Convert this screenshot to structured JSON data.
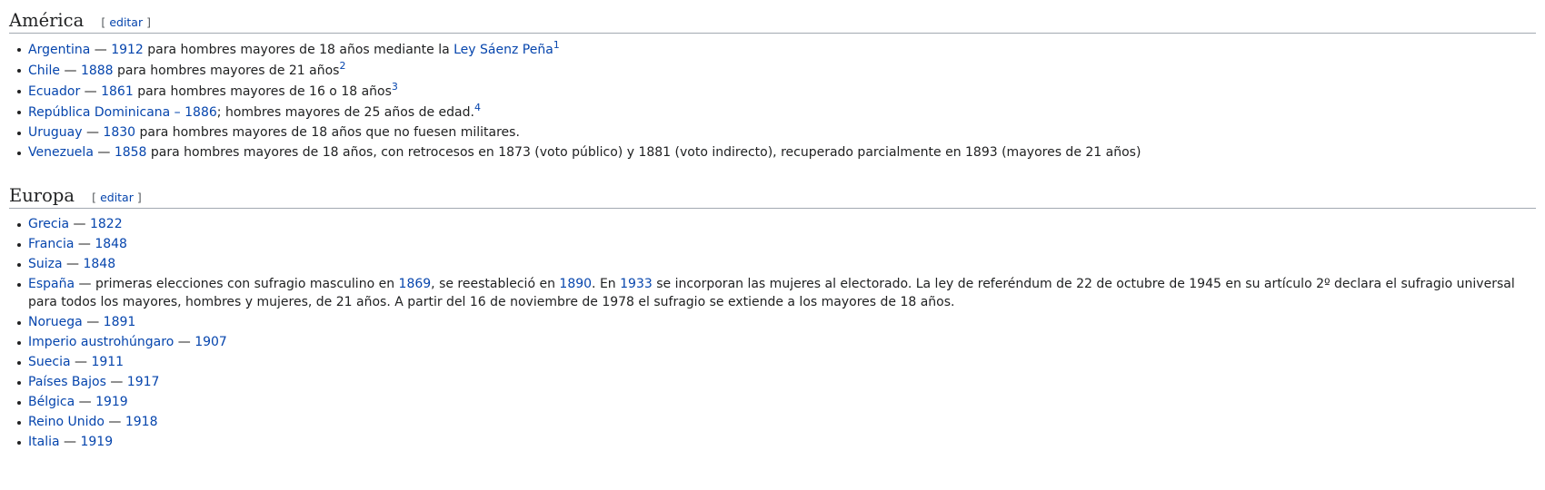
{
  "sections": {
    "america": {
      "title": "América",
      "edit": "editar",
      "items": [
        {
          "link": "Argentina",
          "sep": " — ",
          "year": "1912",
          "text": " para hombres mayores de 18 años mediante la ",
          "link2": "Ley Sáenz Peña",
          "ref": "1"
        },
        {
          "link": "Chile",
          "sep": " — ",
          "year": "1888",
          "text": " para hombres mayores de 21 años",
          "ref": "2"
        },
        {
          "link": "Ecuador",
          "sep": " — ",
          "year": "1861",
          "text": " para hombres mayores de 16 o 18 años",
          "ref": "3"
        },
        {
          "link": "República Dominicana",
          "sep": " – ",
          "year": "1886",
          "text": "; hombres mayores de 25 años de edad.",
          "ref": "4"
        },
        {
          "link": "Uruguay",
          "sep": " — ",
          "year": "1830",
          "text": " para hombres mayores de 18 años que no fuesen militares."
        },
        {
          "link": "Venezuela",
          "sep": " — ",
          "year": "1858",
          "text": " para hombres mayores de 18 años, con retrocesos en 1873 (voto público) y 1881 (voto indirecto), recuperado parcialmente en 1893 (mayores de 21 años)"
        }
      ]
    },
    "europa": {
      "title": "Europa",
      "edit": "editar",
      "items": [
        {
          "link": "Grecia",
          "sep": " — ",
          "year": "1822"
        },
        {
          "link": "Francia",
          "sep": " — ",
          "year": "1848"
        },
        {
          "link": "Suiza",
          "sep": " — ",
          "year": "1848"
        },
        {
          "link": "España",
          "sep": " — ",
          "text_a": "primeras elecciones con sufragio masculino en ",
          "year_a": "1869",
          "text_b": ", se reestableció en ",
          "year_b": "1890",
          "text_c": ". En ",
          "year_c": "1933",
          "text_d": " se incorporan las mujeres al electorado. La ley de referéndum de 22 de octubre de 1945 en su artículo 2º declara el sufragio universal para todos los mayores, hombres y mujeres, de 21 años. A partir del 16 de noviembre de 1978 el sufragio se extiende a los mayores de 18 años."
        },
        {
          "link": "Noruega",
          "sep": " — ",
          "year": "1891"
        },
        {
          "link": "Imperio austrohúngaro",
          "sep": " — ",
          "year": "1907"
        },
        {
          "link": "Suecia",
          "sep": " — ",
          "year": "1911"
        },
        {
          "link": "Países Bajos",
          "sep": " — ",
          "year": "1917"
        },
        {
          "link": "Bélgica",
          "sep": " — ",
          "year": "1919"
        },
        {
          "link": "Reino Unido",
          "sep": " — ",
          "year": "1918"
        },
        {
          "link": "Italia",
          "sep": " — ",
          "year": "1919"
        }
      ]
    }
  }
}
